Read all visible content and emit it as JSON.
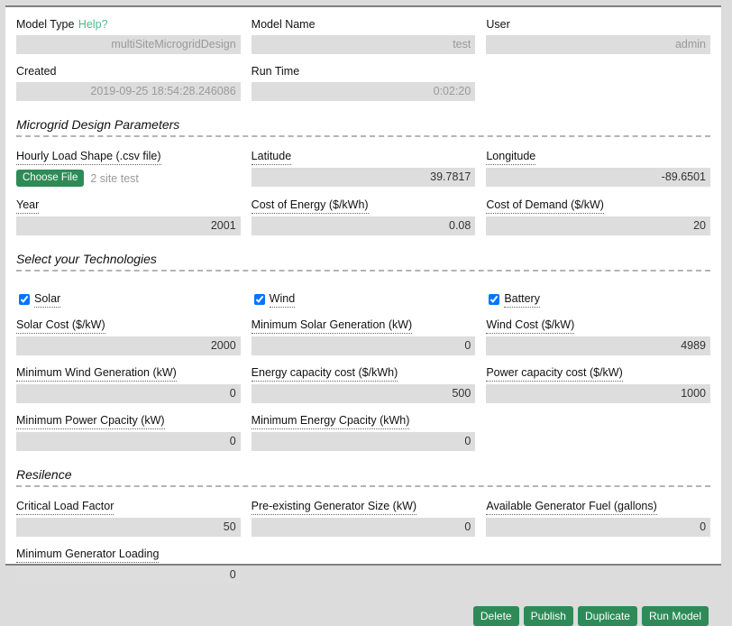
{
  "header": {
    "fields": [
      {
        "label": "Model Type",
        "help": "Help?",
        "value": "multiSiteMicrogridDesign",
        "muted": true
      },
      {
        "label": "Model Name",
        "value": "test",
        "muted": true
      },
      {
        "label": "User",
        "value": "admin",
        "muted": true
      },
      {
        "label": "Created",
        "value": "2019-09-25 18:54:28.246086",
        "muted": true
      },
      {
        "label": "Run Time",
        "value": "0:02:20",
        "muted": true
      }
    ]
  },
  "sections": [
    {
      "title": "Microgrid Design Parameters",
      "fields": [
        {
          "label": "Hourly Load Shape (.csv file)",
          "type": "file",
          "button": "Choose File",
          "filename": "2 site test"
        },
        {
          "label": "Latitude",
          "value": "39.7817"
        },
        {
          "label": "Longitude",
          "value": "-89.6501"
        },
        {
          "label": "Year",
          "value": "2001"
        },
        {
          "label": "Cost of Energy ($/kWh)",
          "value": "0.08"
        },
        {
          "label": "Cost of Demand ($/kW)",
          "value": "20"
        }
      ]
    },
    {
      "title": "Select your Technologies",
      "checkboxes": [
        {
          "label": "Solar",
          "checked": true
        },
        {
          "label": "Wind",
          "checked": true
        },
        {
          "label": "Battery",
          "checked": true
        }
      ],
      "fields": [
        {
          "label": "Solar Cost ($/kW)",
          "value": "2000"
        },
        {
          "label": "Minimum Solar Generation (kW)",
          "value": "0"
        },
        {
          "label": "Wind Cost ($/kW)",
          "value": "4989"
        },
        {
          "label": "Minimum Wind Generation (kW)",
          "value": "0"
        },
        {
          "label": "Energy capacity cost ($/kWh)",
          "value": "500"
        },
        {
          "label": "Power capacity cost ($/kW)",
          "value": "1000"
        },
        {
          "label": "Minimum Power Cpacity (kW)",
          "value": "0"
        },
        {
          "label": "Minimum Energy Cpacity (kWh)",
          "value": "0"
        }
      ]
    },
    {
      "title": "Resilence",
      "fields": [
        {
          "label": "Critical Load Factor",
          "value": "50"
        },
        {
          "label": "Pre-existing Generator Size (kW)",
          "value": "0"
        },
        {
          "label": "Available Generator Fuel (gallons)",
          "value": "0"
        },
        {
          "label": "Minimum Generator Loading",
          "value": "0"
        }
      ]
    }
  ],
  "actions": [
    {
      "label": "Delete"
    },
    {
      "label": "Publish"
    },
    {
      "label": "Duplicate"
    },
    {
      "label": "Run Model"
    }
  ],
  "colors": {
    "accent_green": "#2e8b57",
    "help_link": "#4cbb87",
    "input_bg": "#dddddd",
    "page_bg": "#dcdcdc"
  }
}
